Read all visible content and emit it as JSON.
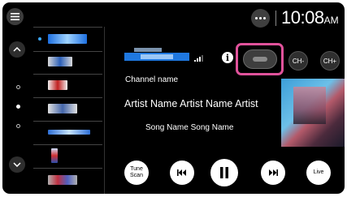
{
  "status_bar": {
    "time": "10:08",
    "ampm": "AM"
  },
  "channel": {
    "name": "Channel name",
    "artist": "Artist Name Artist Name Artist",
    "song": "Song Name Song Name"
  },
  "buttons": {
    "ch_minus": "CH-",
    "ch_plus": "CH+",
    "tune_scan": "Tune Scan",
    "live": "Live"
  },
  "presets": [
    {
      "name": "preset-1",
      "active": true
    },
    {
      "name": "preset-2",
      "active": false
    },
    {
      "name": "preset-3",
      "active": false
    },
    {
      "name": "preset-4",
      "active": false
    },
    {
      "name": "preset-5",
      "active": false
    },
    {
      "name": "preset-6",
      "active": false
    },
    {
      "name": "preset-7",
      "active": false
    }
  ],
  "page_indicator": {
    "pages": 3,
    "current": 2
  },
  "colors": {
    "highlight": "#e0529b",
    "accent": "#3da9ff",
    "background": "#000000"
  },
  "icons": [
    "menu-icon",
    "chevron-up-icon",
    "chevron-down-icon",
    "more-icon",
    "info-icon",
    "signal-icon",
    "skip-back-icon",
    "pause-icon",
    "skip-forward-icon"
  ]
}
